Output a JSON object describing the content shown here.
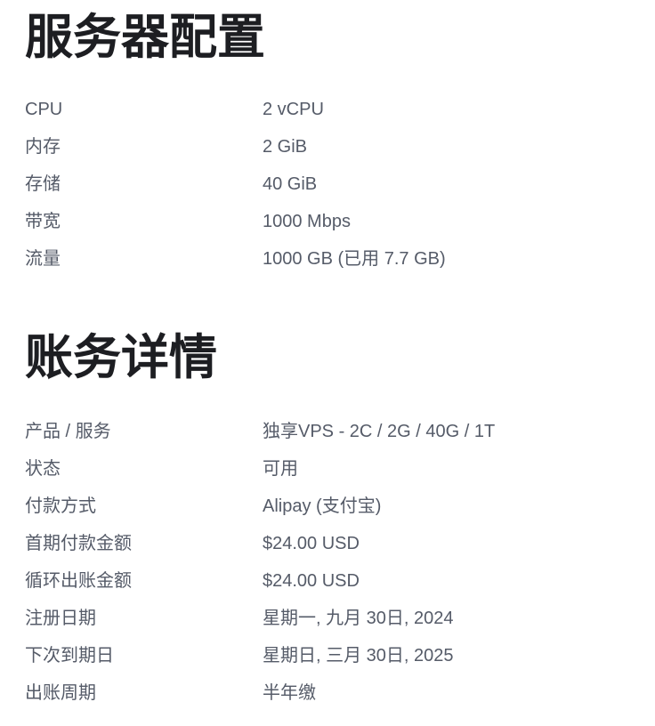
{
  "sections": [
    {
      "id": "server-config",
      "heading": "服务器配置",
      "rows": [
        {
          "label": "CPU",
          "value": "2 vCPU"
        },
        {
          "label": "内存",
          "value": "2 GiB"
        },
        {
          "label": "存储",
          "value": "40 GiB"
        },
        {
          "label": "带宽",
          "value": "1000 Mbps"
        },
        {
          "label": "流量",
          "value": "1000 GB (已用 7.7 GB)"
        }
      ]
    },
    {
      "id": "billing-details",
      "heading": "账务详情",
      "rows": [
        {
          "label": "产品 / 服务",
          "value": "独享VPS - 2C / 2G / 40G / 1T"
        },
        {
          "label": "状态",
          "value": "可用"
        },
        {
          "label": "付款方式",
          "value": "Alipay (支付宝)"
        },
        {
          "label": "首期付款金额",
          "value": "$24.00 USD"
        },
        {
          "label": "循环出账金额",
          "value": "$24.00 USD"
        },
        {
          "label": "注册日期",
          "value": "星期一, 九月 30日, 2024"
        },
        {
          "label": "下次到期日",
          "value": "星期日, 三月 30日, 2025"
        },
        {
          "label": "出账周期",
          "value": "半年缴"
        }
      ]
    }
  ],
  "colors": {
    "background": "#ffffff",
    "heading_text": "#1d1e22",
    "body_text": "#555b68"
  }
}
